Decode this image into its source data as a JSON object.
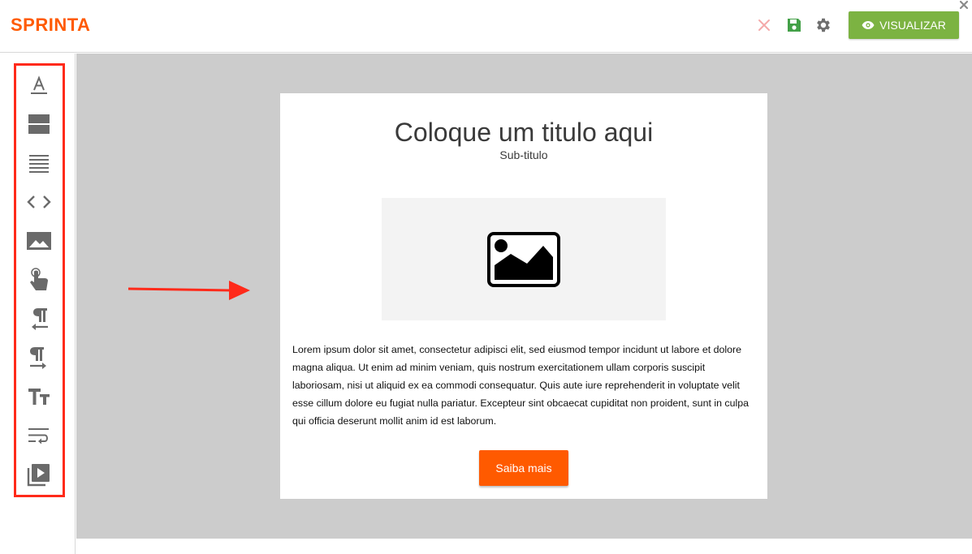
{
  "header": {
    "logo": "SPRINTA",
    "discard_icon": "close-icon",
    "save_icon": "save-icon",
    "settings_icon": "gear-icon",
    "view_button_label": "VISUALIZAR",
    "view_button_icon": "eye-icon",
    "window_close_icon": "close-icon"
  },
  "sidebar": {
    "tools": [
      {
        "name": "text-icon"
      },
      {
        "name": "layout-rows-icon"
      },
      {
        "name": "lines-icon"
      },
      {
        "name": "code-icon"
      },
      {
        "name": "image-icon"
      },
      {
        "name": "touch-button-icon"
      },
      {
        "name": "paragraph-rtl-icon"
      },
      {
        "name": "paragraph-ltr-icon"
      },
      {
        "name": "text-size-icon"
      },
      {
        "name": "wrap-text-icon"
      },
      {
        "name": "video-library-icon"
      }
    ]
  },
  "template": {
    "title": "Coloque um titulo aqui",
    "subtitle": "Sub-titulo",
    "image_placeholder_icon": "image-icon",
    "body": "Lorem ipsum dolor sit amet, consectetur adipisci elit, sed eiusmod tempor incidunt ut labore et dolore magna aliqua. Ut enim ad minim veniam, quis nostrum exercitationem ullam corporis suscipit laboriosam, nisi ut aliquid ex ea commodi consequatur. Quis aute iure reprehenderit in voluptate velit esse cillum dolore eu fugiat nulla pariatur. Excepteur sint obcaecat cupiditat non proident, sunt in culpa qui officia deserunt mollit anim id est laborum.",
    "button_label": "Saiba mais"
  },
  "colors": {
    "brand": "#ff5a00",
    "view_button": "#7cb342",
    "save_icon": "#43a047",
    "annotation": "#ff2a1a",
    "canvas_bg": "#cccccc"
  }
}
